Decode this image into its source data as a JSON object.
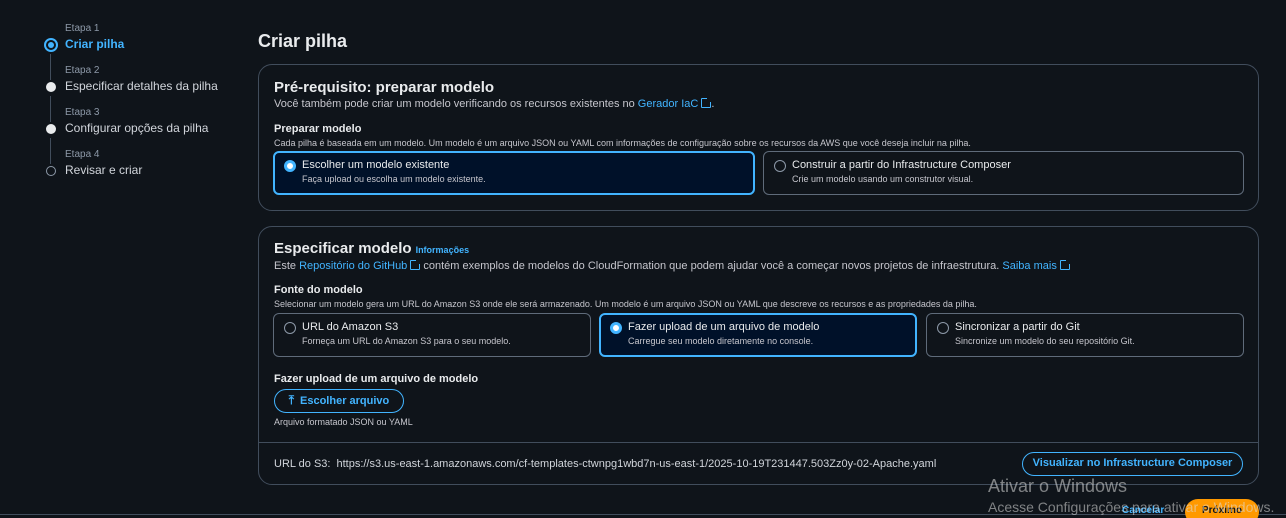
{
  "steps": [
    {
      "num": "Etapa 1",
      "label": "Criar pilha",
      "state": "active"
    },
    {
      "num": "Etapa 2",
      "label": "Especificar detalhes da pilha",
      "state": "done"
    },
    {
      "num": "Etapa 3",
      "label": "Configurar opções da pilha",
      "state": "done"
    },
    {
      "num": "Etapa 4",
      "label": "Revisar e criar",
      "state": "pending"
    }
  ],
  "page_title": "Criar pilha",
  "prereq": {
    "title": "Pré-requisito: preparar modelo",
    "desc_prefix": "Você também pode criar um modelo verificando os recursos existentes no ",
    "desc_link": "Gerador IaC",
    "desc_suffix": ".",
    "field_label": "Preparar modelo",
    "field_hint": "Cada pilha é baseada em um modelo. Um modelo é um arquivo JSON ou YAML com informações de configuração sobre os recursos da AWS que você deseja incluir na pilha.",
    "options": [
      {
        "title": "Escolher um modelo existente",
        "sub": "Faça upload ou escolha um modelo existente.",
        "selected": true
      },
      {
        "title": "Construir a partir do Infrastructure Composer",
        "sub": "Crie um modelo usando um construtor visual.",
        "selected": false
      }
    ]
  },
  "spec": {
    "title": "Especificar modelo",
    "info": "Informações",
    "desc_prefix": "Este ",
    "desc_link": "Repositório do GitHub",
    "desc_middle": " contém exemplos de modelos do CloudFormation que podem ajudar você a começar novos projetos de infraestrutura. ",
    "desc_link2": "Saiba mais",
    "field_label": "Fonte do modelo",
    "field_hint": "Selecionar um modelo gera um URL do Amazon S3 onde ele será armazenado. Um modelo é um arquivo JSON ou YAML que descreve os recursos e as propriedades da pilha.",
    "options": [
      {
        "title": "URL do Amazon S3",
        "sub": "Forneça um URL do Amazon S3 para o seu modelo.",
        "selected": false
      },
      {
        "title": "Fazer upload de um arquivo de modelo",
        "sub": "Carregue seu modelo diretamente no console.",
        "selected": true
      },
      {
        "title": "Sincronizar a partir do Git",
        "sub": "Sincronize um modelo do seu repositório Git.",
        "selected": false
      }
    ],
    "upload_label": "Fazer upload de um arquivo de modelo",
    "upload_button": "Escolher arquivo",
    "upload_hint": "Arquivo formatado JSON ou YAML",
    "s3_label": "URL do S3:",
    "s3_url": "https://s3.us-east-1.amazonaws.com/cf-templates-ctwnpg1wbd7n-us-east-1/2025-10-19T231447.503Zz0y-02-Apache.yaml",
    "viz_button": "Visualizar no Infrastructure Composer"
  },
  "footer": {
    "cancel": "Cancelar",
    "next": "Próximo"
  },
  "watermark": {
    "line1": "Ativar o Windows",
    "line2": "Acesse Configurações para ativar o Windows."
  },
  "colors": {
    "accent": "#42b4ff",
    "primary_button": "#ff9900",
    "background": "#0f141a"
  }
}
